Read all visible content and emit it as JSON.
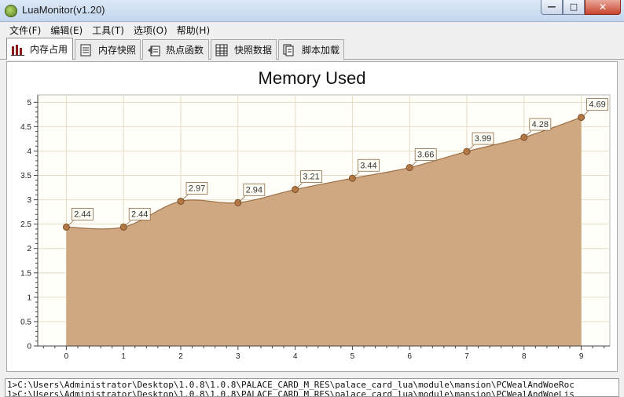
{
  "window": {
    "title": "LuaMonitor(v1.20)",
    "buttons": {
      "minimize": "—",
      "maximize": "□",
      "close": "✕"
    }
  },
  "menu": [
    {
      "label": "文件(F)"
    },
    {
      "label": "编辑(E)"
    },
    {
      "label": "工具(T)"
    },
    {
      "label": "选项(O)"
    },
    {
      "label": "帮助(H)"
    }
  ],
  "tabs": [
    {
      "label": "内存占用",
      "icon": "bar-chart-icon",
      "active": true
    },
    {
      "label": "内存快照",
      "icon": "document-icon",
      "active": false
    },
    {
      "label": "热点函数",
      "icon": "hotspot-icon",
      "active": false
    },
    {
      "label": "快照数据",
      "icon": "grid-icon",
      "active": false
    },
    {
      "label": "脚本加载",
      "icon": "pages-icon",
      "active": false
    }
  ],
  "chart_data": {
    "type": "area",
    "title": "Memory Used",
    "xlabel": "",
    "ylabel": "",
    "x": [
      0,
      1,
      2,
      3,
      4,
      5,
      6,
      7,
      8,
      9
    ],
    "values": [
      2.44,
      2.44,
      2.97,
      2.94,
      3.21,
      3.44,
      3.66,
      3.99,
      4.28,
      4.69
    ],
    "data_labels": [
      "2.44",
      "2.44",
      "2.97",
      "2.94",
      "3.21",
      "3.44",
      "3.66",
      "3.99",
      "4.28",
      "4.69"
    ],
    "xlim": [
      -0.5,
      9.5
    ],
    "ylim": [
      0,
      5.15
    ],
    "y_ticks": [
      "0",
      "0.5",
      "1",
      "1.5",
      "2",
      "2.5",
      "3",
      "3.5",
      "4",
      "4.5",
      "5"
    ],
    "x_ticks": [
      "0",
      "1",
      "2",
      "3",
      "4",
      "5",
      "6",
      "7",
      "8",
      "9"
    ],
    "grid": true,
    "legend": "none",
    "colors": {
      "fill": "#cfa882",
      "line": "#9c6f47",
      "marker": "#b87a45",
      "grid": "#e6dcc6",
      "label_border": "#8b6a45"
    }
  },
  "console": {
    "lines": [
      "1>C:\\Users\\Administrator\\Desktop\\1.0.8\\1.0.8\\PALACE_CARD_M_RES\\palace_card_lua\\module\\mansion\\PCWealAndWoeRoc",
      "1>C:\\Users\\Administrator\\Desktop\\1.0.8\\1.0.8\\PALACE_CARD_M_RES\\palace_card_lua\\module\\mansion\\PCWealAndWoeLis"
    ]
  }
}
